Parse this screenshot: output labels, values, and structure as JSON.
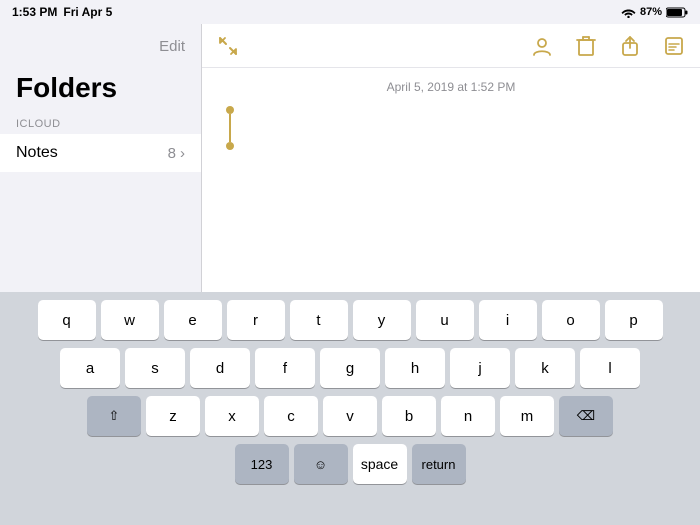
{
  "statusBar": {
    "time": "1:53 PM",
    "day": "Fri Apr 5",
    "battery": "87%",
    "wifi": true,
    "signal": true
  },
  "leftPanel": {
    "editLabel": "Edit",
    "title": "Folders",
    "icloudLabel": "ICLOUD",
    "notesRow": {
      "label": "Notes",
      "count": "8",
      "chevron": "›"
    }
  },
  "rightPanel": {
    "date": "April 5, 2019 at 1:52 PM",
    "toolbar": {
      "expandIcon": "⤢",
      "shareIcon": "🗑",
      "uploadIcon": "⬆",
      "editIcon": "✏"
    }
  },
  "keyboard": {
    "rows": [
      [
        "q",
        "w",
        "e",
        "r",
        "t",
        "y",
        "u",
        "i",
        "o",
        "p"
      ],
      [
        "a",
        "s",
        "d",
        "f",
        "g",
        "h",
        "j",
        "k",
        "l"
      ],
      [
        "shift",
        "z",
        "x",
        "c",
        "v",
        "b",
        "n",
        "m",
        "⌫"
      ],
      [
        "123",
        "space",
        "return"
      ]
    ]
  }
}
